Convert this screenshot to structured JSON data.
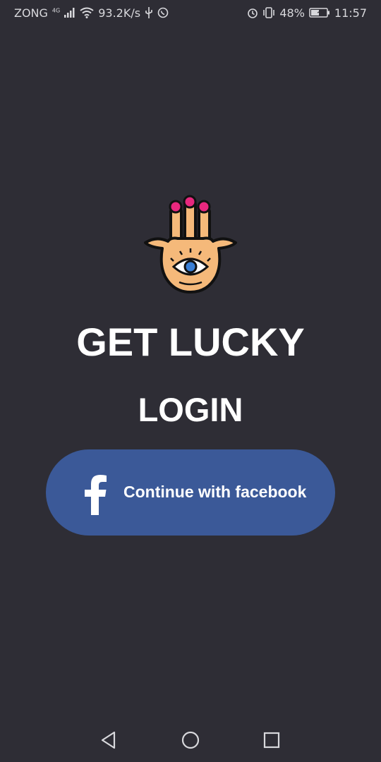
{
  "status_bar": {
    "carrier": "ZONG",
    "network_type": "4G",
    "speed": "93.2K/s",
    "battery": "48%",
    "time": "11:57",
    "icons": [
      "signal-icon",
      "wifi-icon",
      "usb-icon",
      "whatsapp-icon",
      "alarm-icon",
      "vibrate-icon",
      "battery-icon"
    ]
  },
  "app": {
    "logo_icon": "hamsa-hand-icon",
    "title": "GET LUCKY",
    "login_heading": "LOGIN",
    "facebook_button_label": "Continue with facebook",
    "facebook_icon": "facebook-icon"
  },
  "nav_bar": {
    "icons": [
      "back-icon",
      "home-icon",
      "recents-icon"
    ]
  },
  "colors": {
    "background": "#2e2d35",
    "facebook_blue": "#3b5998",
    "text": "#ffffff",
    "logo_skin": "#f5b97a",
    "logo_nail": "#e8287e",
    "logo_eye": "#3a7fd5"
  }
}
